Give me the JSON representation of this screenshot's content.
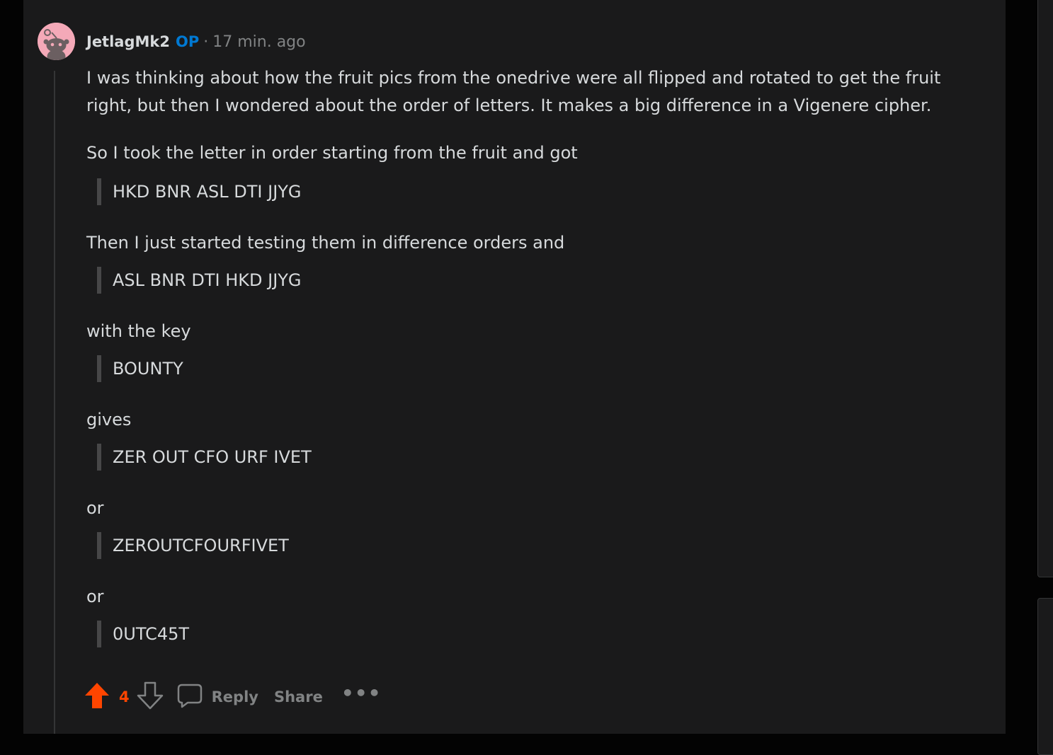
{
  "comment": {
    "author": "JetlagMk2",
    "op_badge": "OP",
    "separator": "·",
    "timestamp": "17 min. ago",
    "paragraphs": [
      "I was thinking about how the fruit pics from the onedrive were all flipped and rotated to get the fruit right, but then I wondered about the order of letters. It makes a big difference in a Vigenere cipher.",
      "So I took the letter in order starting from the fruit and got",
      "HKD BNR ASL DTI JJYG",
      "Then I just started testing them in difference orders and",
      "ASL BNR DTI HKD JJYG",
      "with the key",
      "BOUNTY",
      "gives",
      "ZER OUT CFO URF IVET",
      "or",
      "ZEROUTCFOURFIVET",
      "or",
      "0UTC45T"
    ],
    "score": "4",
    "reply_label": "Reply",
    "share_label": "Share",
    "more_label": "•••"
  },
  "colors": {
    "background": "#1a1a1b",
    "text": "#d7dadc",
    "muted": "#818384",
    "op_blue": "#0079d3",
    "upvote_orange": "#ff4500",
    "avatar_pink": "#f4a9b8"
  },
  "icons": [
    "snoo-avatar-icon",
    "upvote-arrow-icon",
    "downvote-arrow-icon",
    "comment-bubble-icon",
    "more-options-icon"
  ]
}
